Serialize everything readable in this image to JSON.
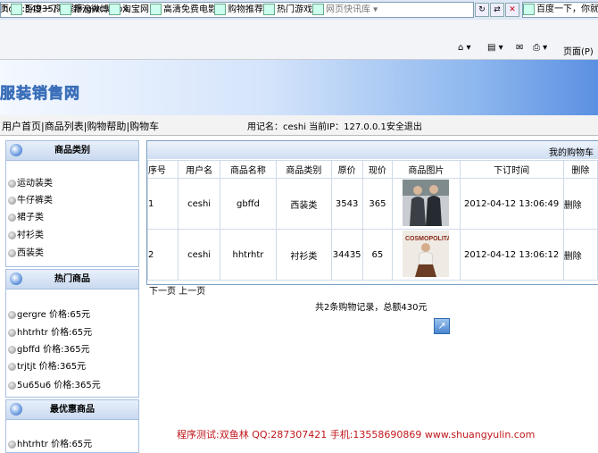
{
  "browser": {
    "address": "host:54935/源程序/gwc.aspx",
    "search_placeholder": "百度一下，你就知道",
    "favorites": [
      {
        "label": "百度一下",
        "icon": "baidu-icon"
      },
      {
        "label": "新浪微博",
        "icon": "weibo-icon"
      },
      {
        "label": "淘宝网",
        "icon": "taobao-icon"
      },
      {
        "label": "高清免费电影",
        "icon": "movie-icon"
      },
      {
        "label": "购物推荐",
        "icon": "shopping-icon"
      },
      {
        "label": "热门游戏",
        "icon": "game-icon"
      },
      {
        "label": "网页快讯库",
        "icon": "webslice-icon"
      }
    ],
    "page_menu": "页面(P)"
  },
  "site": {
    "title": "服装销售网"
  },
  "nav": {
    "links": [
      "用户首页",
      "商品列表",
      "购物帮助",
      "购物车"
    ],
    "user_info": "用记名：ceshi   当前IP：127.0.0.1安全退出"
  },
  "sidebar": {
    "categories": {
      "title": "商品类别",
      "items": [
        "运动装类",
        "牛仔裤类",
        "裙子类",
        "衬衫类",
        "西装类"
      ]
    },
    "hot": {
      "title": "热门商品",
      "items": [
        "gergre 价格:65元",
        "hhtrhtr 价格:65元",
        "gbffd 价格:365元",
        "trjtjt 价格:365元",
        "5u65u6 价格:365元"
      ]
    },
    "deals": {
      "title": "最优惠商品",
      "items": [
        "hhtrhtr 价格:65元"
      ]
    }
  },
  "cart": {
    "title": "我的购物车",
    "columns": [
      "序号",
      "用户名",
      "商品名称",
      "商品类别",
      "原价",
      "现价",
      "商品图片",
      "下订时间",
      "删除"
    ],
    "rows": [
      {
        "no": "1",
        "user": "ceshi",
        "name": "gbffd",
        "category": "西装类",
        "orig": "3543",
        "price": "365",
        "image": "couple-photo",
        "time": "2012-04-12 13:06:49",
        "del": "删除"
      },
      {
        "no": "2",
        "user": "ceshi",
        "name": "hhtrhtr",
        "category": "衬衫类",
        "orig": "34435",
        "price": "65",
        "image": "cosmopolitan-cover",
        "time": "2012-04-12 13:06:12",
        "del": "删除"
      }
    ],
    "pager": "下一页 上一页",
    "summary": "共2条购物记录，总额430元"
  },
  "footer": "程序测试:双鱼林 QQ:287307421 手机:13558690869 www.shuangyulin.com"
}
